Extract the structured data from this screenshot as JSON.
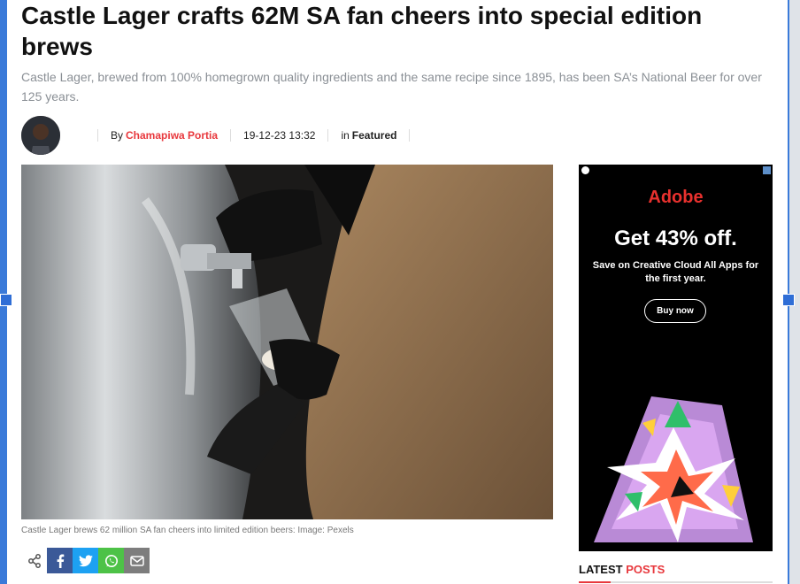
{
  "article": {
    "title": "Castle Lager crafts 62M SA fan cheers into special edition brews",
    "subtitle": "Castle Lager, brewed from 100% homegrown quality ingredients and the same recipe since 1895, has been SA’s National Beer for over 125 years.",
    "byline_prefix": "By",
    "author": "Chamapiwa Portia",
    "datetime": "19-12-23 13:32",
    "category_prefix": "in",
    "category": "Featured",
    "image_caption": "Castle Lager brews 62 million SA fan cheers into limited edition beers: Image: Pexels"
  },
  "share": {
    "icons": [
      "share-icon",
      "facebook-icon",
      "twitter-icon",
      "whatsapp-icon",
      "email-icon"
    ],
    "colors": {
      "facebook": "#3b5998",
      "twitter": "#1da1f2",
      "whatsapp": "#4dc247",
      "email": "#7d7d7d"
    }
  },
  "ad": {
    "brand": "Adobe",
    "headline": "Get 43% off.",
    "body": "Save on Creative Cloud All Apps for the first year.",
    "cta": "Buy now",
    "brand_color": "#e8312e"
  },
  "sidebar": {
    "latest_title_a": "LATEST",
    "latest_title_b": "POSTS",
    "accent_color": "#e8383d"
  }
}
